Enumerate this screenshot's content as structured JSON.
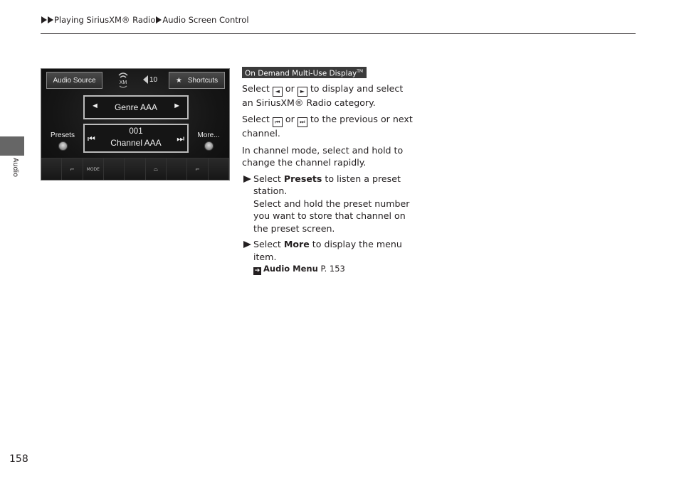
{
  "breadcrumb": {
    "items": [
      "Playing SiriusXM® Radio",
      "Audio Screen Control"
    ]
  },
  "side_tab": {
    "label": "Audio"
  },
  "page_number": "158",
  "screen": {
    "audio_source_button": "Audio Source",
    "xm_icon": "siriusxm-signal-icon",
    "volume_level": "10",
    "shortcuts_button": "Shortcuts",
    "shortcuts_icon": "★",
    "genre_prev": "◄",
    "genre_label": "Genre AAA",
    "genre_next": "►",
    "channel_prev": "⏮",
    "channel_number": "001",
    "channel_name": "Channel AAA",
    "channel_next": "⏭",
    "presets_label": "Presets",
    "more_label": "More...",
    "bottom_bar": {
      "mode_label": "MODE"
    }
  },
  "notes": {
    "badge": "On Demand Multi-Use Display",
    "badge_tm": "TM",
    "para1_a": "Select",
    "para1_or": "or",
    "para1_b": "to display and select an SiriusXM® Radio category.",
    "para2_a": "Select",
    "para2_or": "or",
    "para2_b": "to the previous or next channel.",
    "para3": "In channel mode, select and hold to change the channel rapidly.",
    "bullet1_pre": "Select ",
    "bullet1_bold": "Presets",
    "bullet1_post": " to listen a preset station.",
    "bullet1_extra": "Select and hold the preset number you want to store that channel on the preset screen.",
    "bullet2_pre": "Select ",
    "bullet2_bold": "More",
    "bullet2_post": " to display the menu item.",
    "ref_title": "Audio Menu",
    "ref_page": "P. 153"
  }
}
